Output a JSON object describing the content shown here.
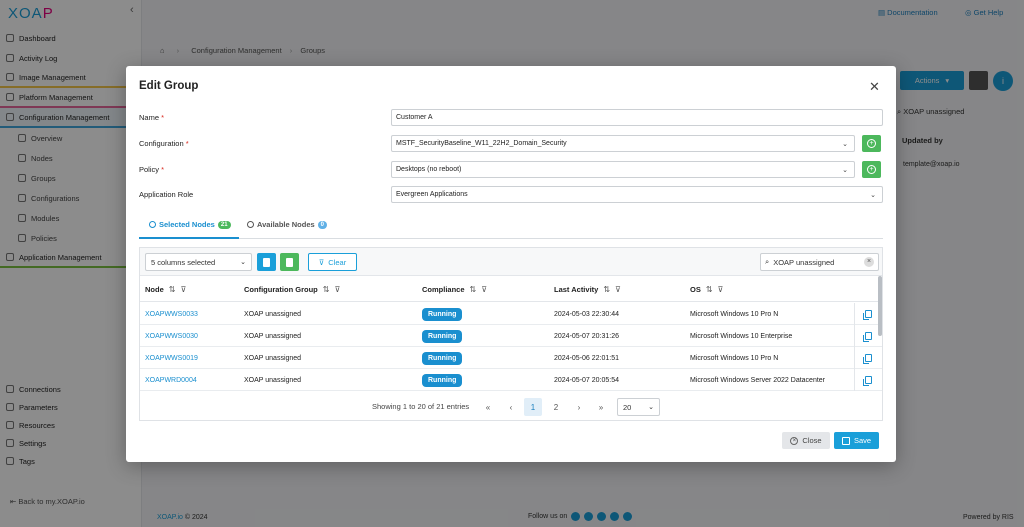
{
  "app": {
    "logo_main": "XOA",
    "logo_accent": "P",
    "collapse_icon": "‹"
  },
  "topbar": {
    "documentation": "Documentation",
    "get_help": "Get Help"
  },
  "breadcrumb": {
    "home_icon": "⌂",
    "section": "Configuration Management",
    "page": "Groups"
  },
  "sidebar": {
    "items": [
      {
        "label": "Dashboard"
      },
      {
        "label": "Activity Log"
      },
      {
        "label": "Image Management"
      },
      {
        "label": "Platform Management"
      },
      {
        "label": "Configuration Management"
      },
      {
        "label": "Overview"
      },
      {
        "label": "Nodes"
      },
      {
        "label": "Groups"
      },
      {
        "label": "Configurations"
      },
      {
        "label": "Modules"
      },
      {
        "label": "Policies"
      },
      {
        "label": "Application Management"
      }
    ],
    "bottom_items": [
      {
        "label": "Connections"
      },
      {
        "label": "Parameters"
      },
      {
        "label": "Resources"
      },
      {
        "label": "Settings"
      },
      {
        "label": "Tags"
      }
    ],
    "back_link": "Back to my.XOAP.io"
  },
  "background_page": {
    "actions_button": "Actions",
    "search_value": "XOAP unassigned",
    "updated_by_header": "Updated by",
    "updated_by_value": "template@xoap.io"
  },
  "footer": {
    "brand": "XOAP.io",
    "copyright": " © 2024",
    "follow_us": "Follow us on",
    "powered_by": "Powered by RIS"
  },
  "modal": {
    "title": "Edit Group",
    "close_icon": "✕",
    "fields": {
      "name": {
        "label": "Name",
        "required": "*",
        "value": "Customer A"
      },
      "configuration": {
        "label": "Configuration",
        "required": "*",
        "value": "MSTF_SecurityBaseline_W11_22H2_Domain_Security"
      },
      "policy": {
        "label": "Policy",
        "required": "*",
        "value": "Desktops (no reboot)"
      },
      "application_role": {
        "label": "Application Role",
        "value": "Evergreen Applications"
      }
    },
    "tabs": {
      "selected": {
        "label": "Selected Nodes",
        "count": "21"
      },
      "available": {
        "label": "Available Nodes",
        "count": "0"
      }
    },
    "toolbar": {
      "columns_selected": "5 columns selected",
      "clear": "Clear",
      "search_value": "XOAP unassigned"
    },
    "table": {
      "headers": [
        "Node",
        "Configuration Group",
        "Compliance",
        "Last Activity",
        "OS"
      ],
      "rows": [
        {
          "node": "XOAPWWS0033",
          "group": "XOAP unassigned",
          "compliance": "Running",
          "last_activity": "2024-05-03 22:30:44",
          "os": "Microsoft Windows 10 Pro N"
        },
        {
          "node": "XOAPWWS0030",
          "group": "XOAP unassigned",
          "compliance": "Running",
          "last_activity": "2024-05-07 20:31:26",
          "os": "Microsoft Windows 10 Enterprise"
        },
        {
          "node": "XOAPWWS0019",
          "group": "XOAP unassigned",
          "compliance": "Running",
          "last_activity": "2024-05-06 22:01:51",
          "os": "Microsoft Windows 10 Pro N"
        },
        {
          "node": "XOAPWRD0004",
          "group": "XOAP unassigned",
          "compliance": "Running",
          "last_activity": "2024-05-07 20:05:54",
          "os": "Microsoft Windows Server 2022 Datacenter"
        }
      ]
    },
    "pagination": {
      "info": "Showing 1 to 20 of 21 entries",
      "first": "«",
      "prev": "‹",
      "pages": [
        "1",
        "2"
      ],
      "next": "›",
      "last": "»",
      "per_page": "20"
    },
    "buttons": {
      "close": "Close",
      "save": "Save"
    }
  },
  "colors": {
    "brand_blue": "#1a9fd9",
    "success_green": "#4cb85c",
    "required_red": "#d9261c"
  }
}
